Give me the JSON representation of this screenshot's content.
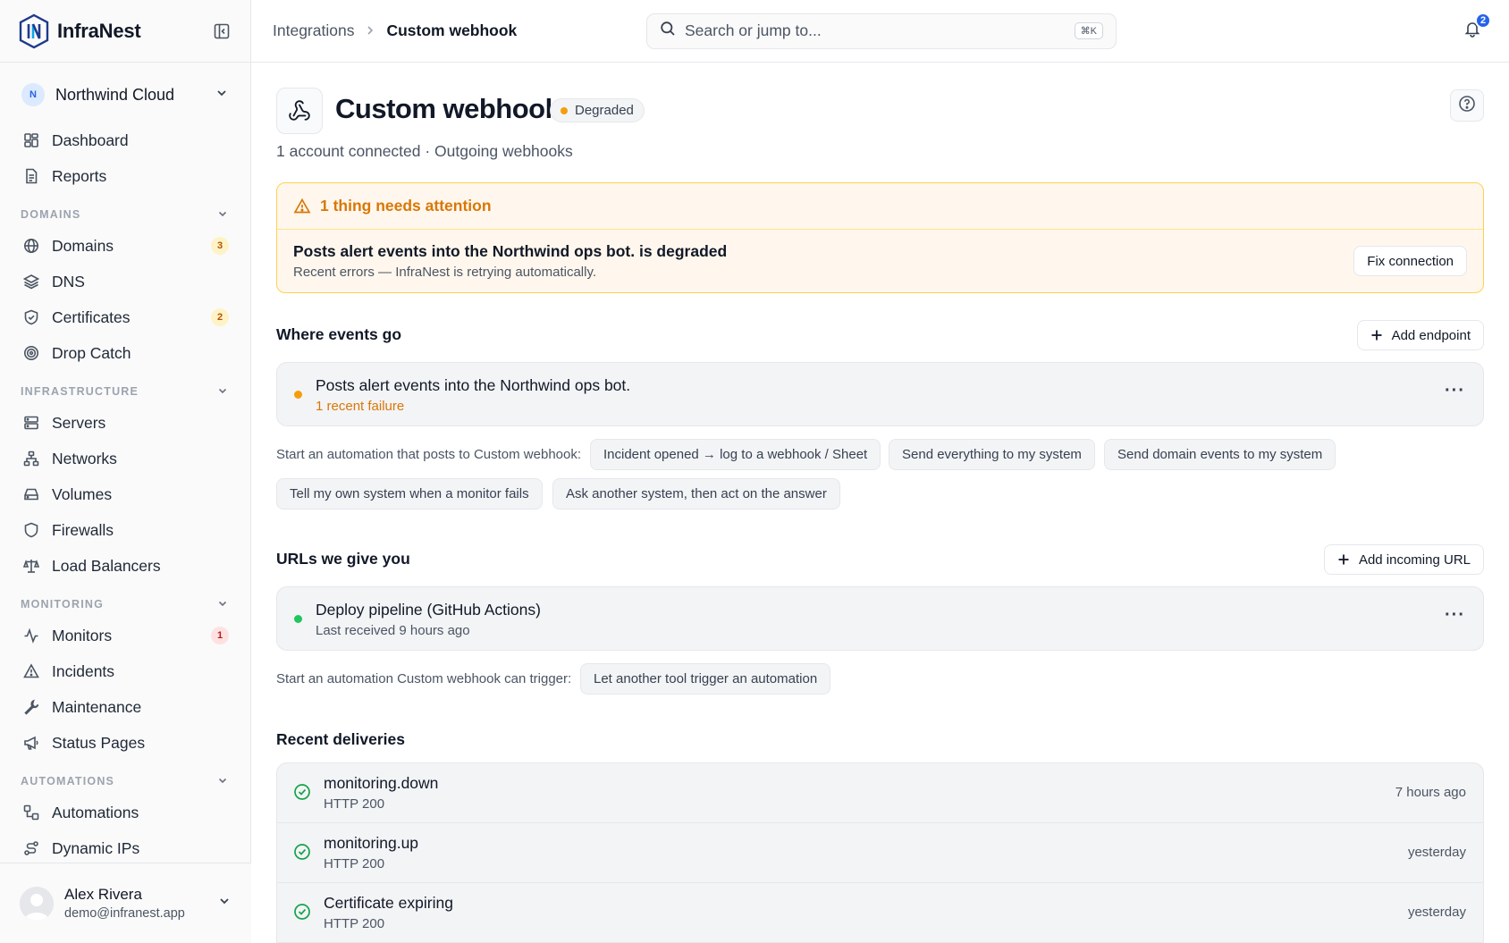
{
  "brand": {
    "name": "InfraNest"
  },
  "org": {
    "initial": "N",
    "name": "Northwind Cloud"
  },
  "nav": {
    "dashboard": "Dashboard",
    "reports": "Reports",
    "sections": {
      "domains": "DOMAINS",
      "infrastructure": "INFRASTRUCTURE",
      "monitoring": "MONITORING",
      "automations": "AUTOMATIONS"
    },
    "domains": {
      "label": "Domains",
      "badge": "3"
    },
    "dns": "DNS",
    "certificates": {
      "label": "Certificates",
      "badge": "2"
    },
    "drop_catch": "Drop Catch",
    "servers": "Servers",
    "networks": "Networks",
    "volumes": "Volumes",
    "firewalls": "Firewalls",
    "load_balancers": "Load Balancers",
    "monitors": {
      "label": "Monitors",
      "badge": "1"
    },
    "incidents": "Incidents",
    "maintenance": "Maintenance",
    "status_pages": "Status Pages",
    "automations": "Automations",
    "dynamic_ips": "Dynamic IPs"
  },
  "user": {
    "name": "Alex Rivera",
    "email": "demo@infranest.app"
  },
  "topbar": {
    "breadcrumb_parent": "Integrations",
    "breadcrumb_current": "Custom webhook",
    "search_placeholder": "Search or jump to...",
    "search_shortcut": "⌘K",
    "notifications_count": "2"
  },
  "header": {
    "title": "Custom webhook",
    "status": "Degraded",
    "subtitle": "1 account connected · Outgoing webhooks"
  },
  "alert": {
    "heading": "1 thing needs attention",
    "title": "Posts alert events into the Northwind ops bot. is degraded",
    "description": "Recent errors — InfraNest is retrying automatically.",
    "action": "Fix connection"
  },
  "events": {
    "title": "Where events go",
    "add_button": "Add endpoint",
    "endpoint": {
      "title": "Posts alert events into the Northwind ops bot.",
      "status": "1 recent failure"
    },
    "automation_label": "Start an automation that posts to Custom webhook:",
    "chips": [
      "Incident opened → log to a webhook / Sheet",
      "Send everything to my system",
      "Send domain events to my system",
      "Tell my own system when a monitor fails",
      "Ask another system, then act on the answer"
    ]
  },
  "urls": {
    "title": "URLs we give you",
    "add_button": "Add incoming URL",
    "item": {
      "title": "Deploy pipeline (GitHub Actions)",
      "status": "Last received 9 hours ago"
    },
    "automation_label": "Start an automation Custom webhook can trigger:",
    "chips": [
      "Let another tool trigger an automation"
    ]
  },
  "deliveries": {
    "title": "Recent deliveries",
    "rows": [
      {
        "event": "monitoring.down",
        "status": "HTTP 200",
        "time": "7 hours ago"
      },
      {
        "event": "monitoring.up",
        "status": "HTTP 200",
        "time": "yesterday"
      },
      {
        "event": "Certificate expiring",
        "status": "HTTP 200",
        "time": "yesterday"
      }
    ]
  },
  "colors": {
    "accent": "#2563eb",
    "warning": "#f59e0b",
    "success": "#16a34a",
    "danger": "#b91c1c"
  }
}
